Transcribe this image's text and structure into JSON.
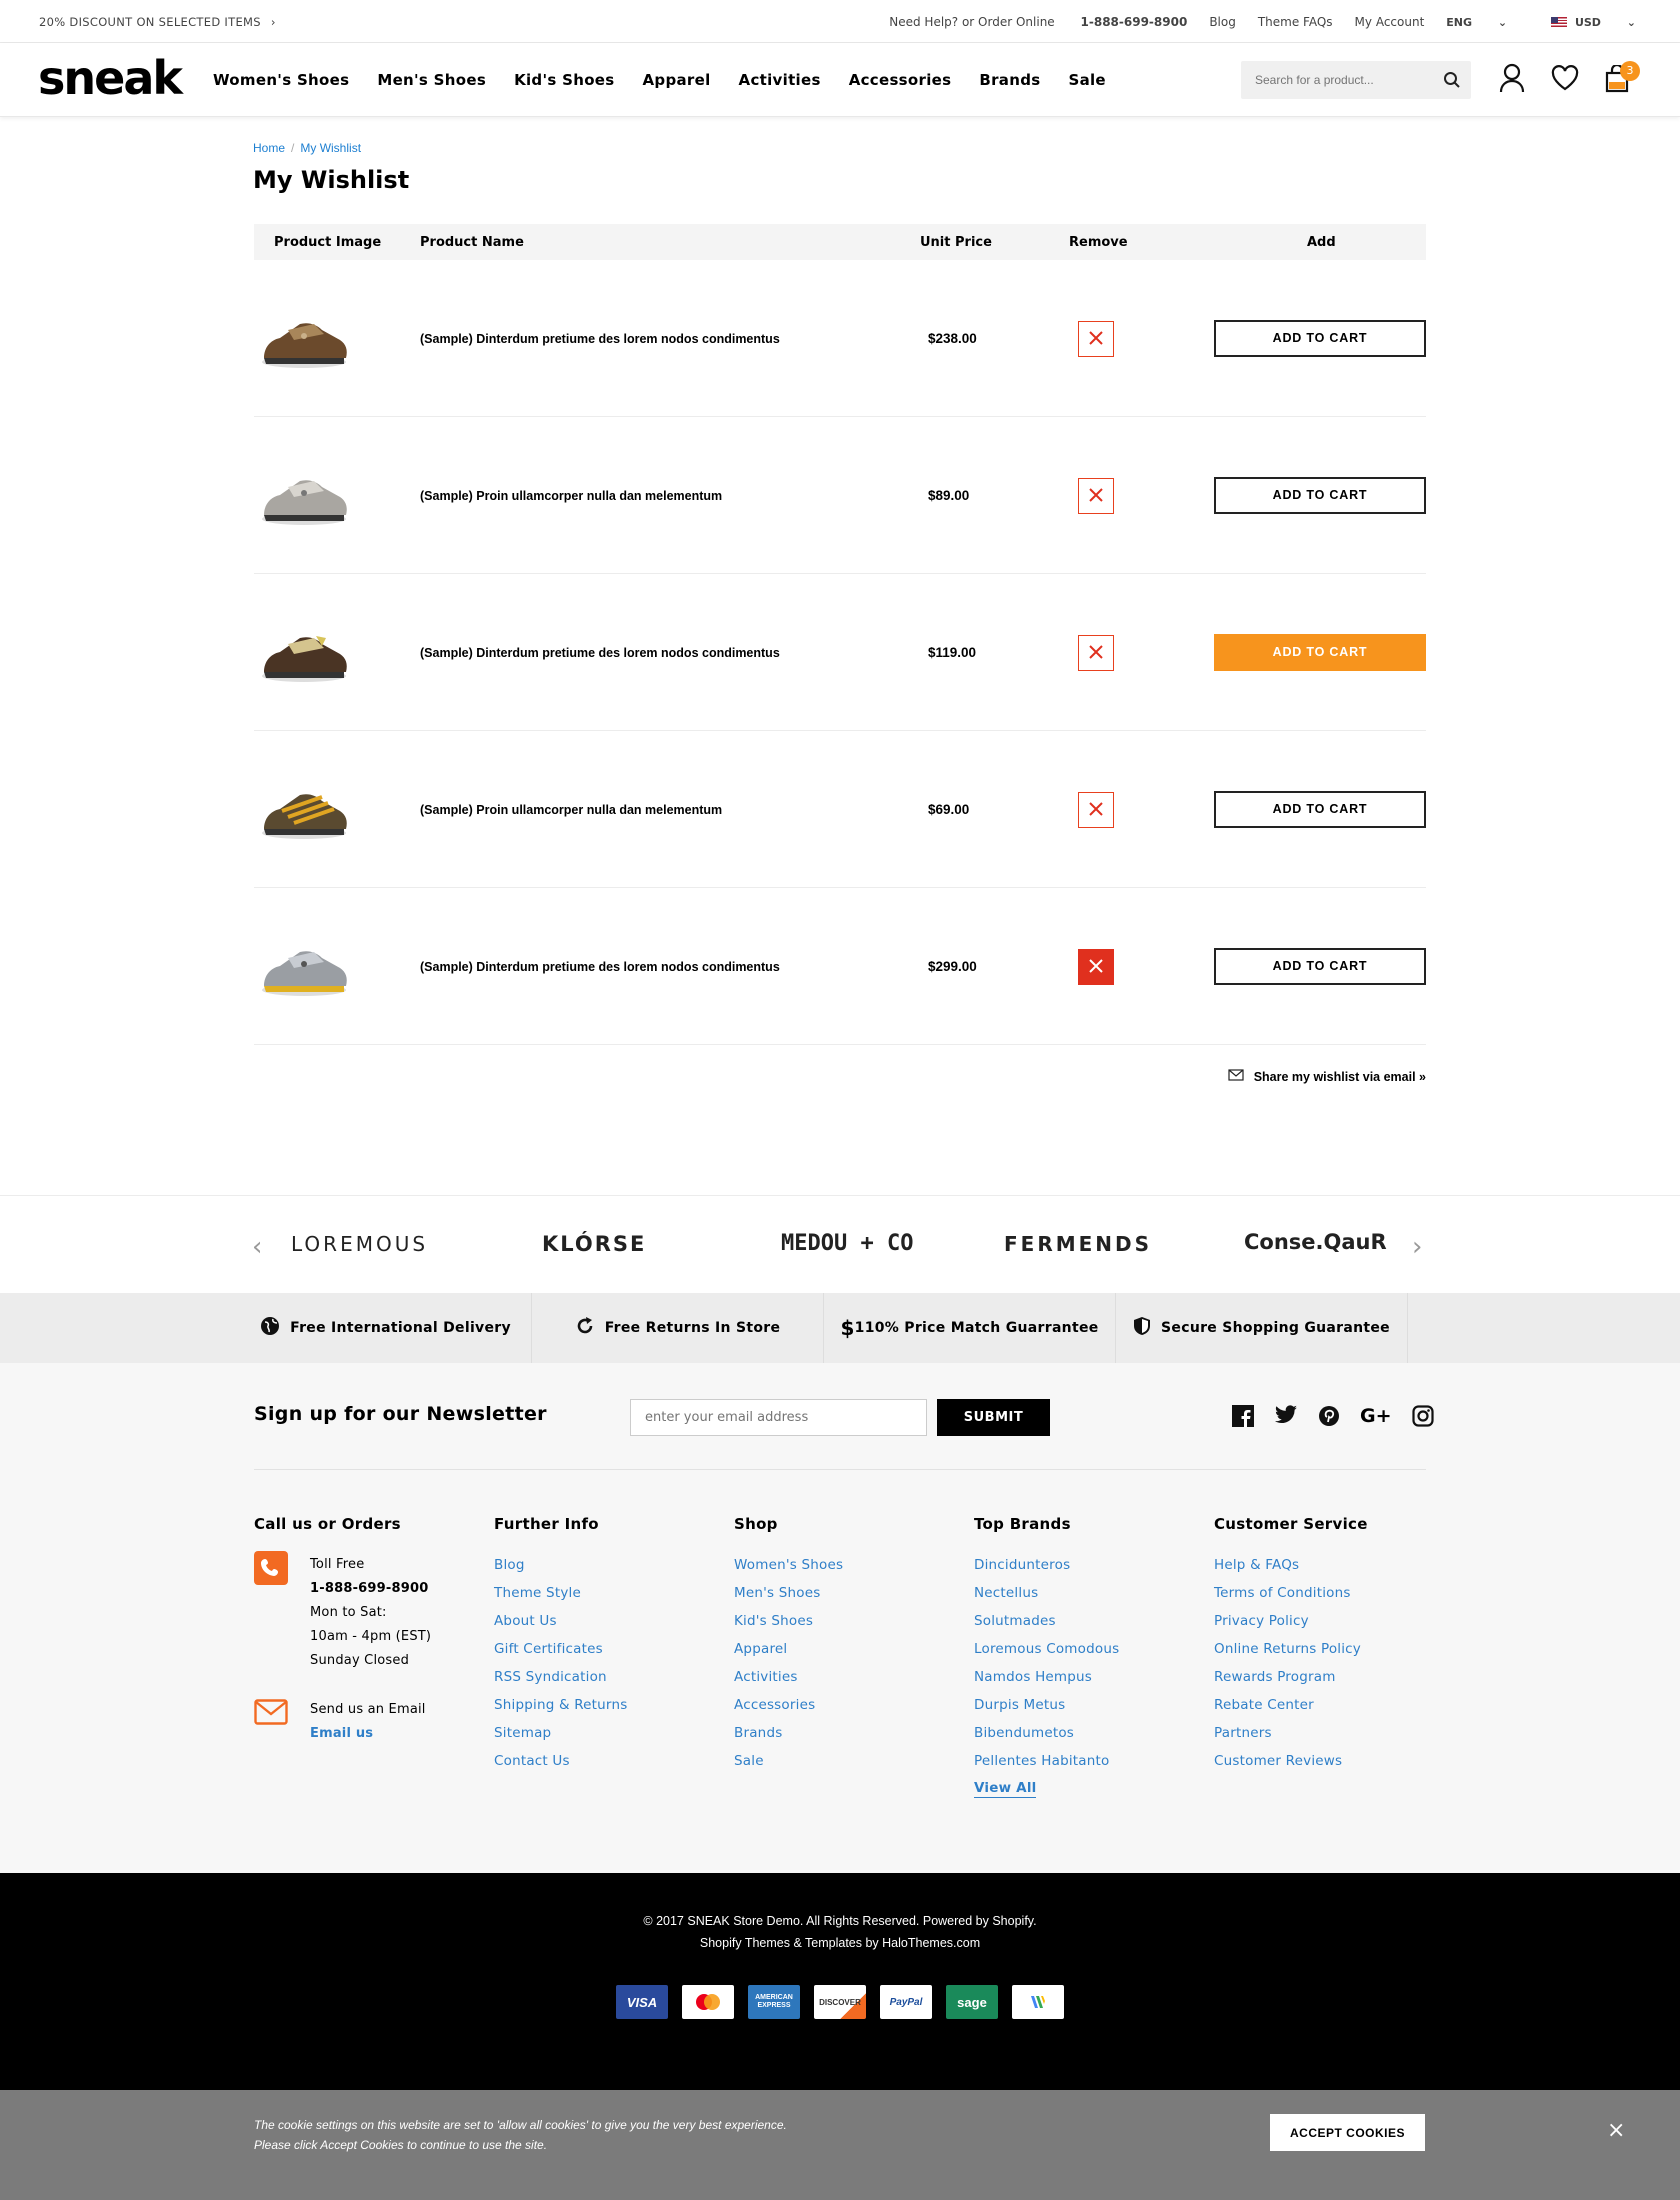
{
  "topbar": {
    "promo": "20% DISCOUNT ON SELECTED ITEMS",
    "help": "Need Help? or Order Online",
    "phone": "1-888-699-8900",
    "blog": "Blog",
    "faqs": "Theme FAQs",
    "account": "My Account",
    "lang": "ENG",
    "currency": "USD"
  },
  "header": {
    "logo": "sneak",
    "nav": [
      "Women's Shoes",
      "Men's Shoes",
      "Kid's Shoes",
      "Apparel",
      "Activities",
      "Accessories",
      "Brands",
      "Sale"
    ],
    "search_placeholder": "Search for a product...",
    "cart_count": "3"
  },
  "breadcrumb": {
    "home": "Home",
    "sep": "/",
    "current": "My Wishlist"
  },
  "page_title": "My Wishlist",
  "table": {
    "headers": {
      "image": "Product Image",
      "name": "Product Name",
      "price": "Unit Price",
      "remove": "Remove",
      "add": "Add"
    },
    "rows": [
      {
        "name": "(Sample) Dinterdum pretiume des lorem nodos condimentus",
        "price": "$238.00",
        "button": "ADD TO CART"
      },
      {
        "name": "(Sample) Proin ullamcorper nulla dan melementum",
        "price": "$89.00",
        "button": "ADD TO CART"
      },
      {
        "name": "(Sample) Dinterdum pretiume des lorem nodos condimentus",
        "price": "$119.00",
        "button": "ADD TO CART"
      },
      {
        "name": "(Sample) Proin ullamcorper nulla dan melementum",
        "price": "$69.00",
        "button": "ADD TO CART"
      },
      {
        "name": "(Sample) Dinterdum pretiume des lorem nodos condimentus",
        "price": "$299.00",
        "button": "ADD TO CART"
      }
    ]
  },
  "share": "Share my wishlist via email »",
  "brands": [
    "LOREMOUS",
    "KLÓRSE",
    "MEDOU + CO",
    "FERMENDS",
    "Conse.QauR"
  ],
  "perks": [
    "Free International Delivery",
    "Free Returns In Store",
    "110% Price Match Guarrantee",
    "Secure Shopping Guarantee"
  ],
  "newsletter": {
    "title": "Sign up for our Newsletter",
    "placeholder": "enter your email address",
    "button": "SUBMIT"
  },
  "footer": {
    "contact": {
      "title": "Call us or Orders",
      "toll": "Toll Free",
      "phone": "1-888-699-8900",
      "days": "Mon to Sat:",
      "hours": "10am - 4pm (EST)",
      "sunday": "Sunday Closed",
      "email_label": "Send us an Email",
      "email_link": "Email us"
    },
    "further": {
      "title": "Further Info",
      "links": [
        "Blog",
        "Theme Style",
        "About Us",
        "Gift Certificates",
        "RSS Syndication",
        "Shipping & Returns",
        "Sitemap",
        "Contact Us"
      ]
    },
    "shop": {
      "title": "Shop",
      "links": [
        "Women's Shoes",
        "Men's Shoes",
        "Kid's Shoes",
        "Apparel",
        "Activities",
        "Accessories",
        "Brands",
        "Sale"
      ]
    },
    "brands": {
      "title": "Top Brands",
      "links": [
        "Dincidunteros",
        "Nectellus",
        "Solutmades",
        "Loremous Comodous",
        "Namdos Hempus",
        "Durpis Metus",
        "Bibendumetos",
        "Pellentes Habitanto"
      ],
      "view_all": "View All"
    },
    "service": {
      "title": "Customer Service",
      "links": [
        "Help & FAQs",
        "Terms of Conditions",
        "Privacy Policy",
        "Online Returns Policy",
        "Rewards Program",
        "Rebate Center",
        "Partners",
        "Customer Reviews"
      ]
    }
  },
  "bottom": {
    "copyright": "© 2017 SNEAK Store Demo. All Rights Reserved. Powered by Shopify.",
    "themes": "Shopify Themes & Templates by HaloThemes.com",
    "payments": [
      "VISA",
      "",
      "AMERICAN EXPRESS",
      "DISCOVER",
      "PayPal",
      "sage",
      ""
    ]
  },
  "cookie": {
    "line1": "The cookie settings on this website are set to 'allow all cookies' to give you the very best experience.",
    "line2": "Please click Accept Cookies to continue to use the site.",
    "button": "ACCEPT COOKIES",
    "close": "×"
  },
  "colors": {
    "accent": "#f7941d",
    "link": "#2f7fc8",
    "remove": "#e0301e"
  }
}
